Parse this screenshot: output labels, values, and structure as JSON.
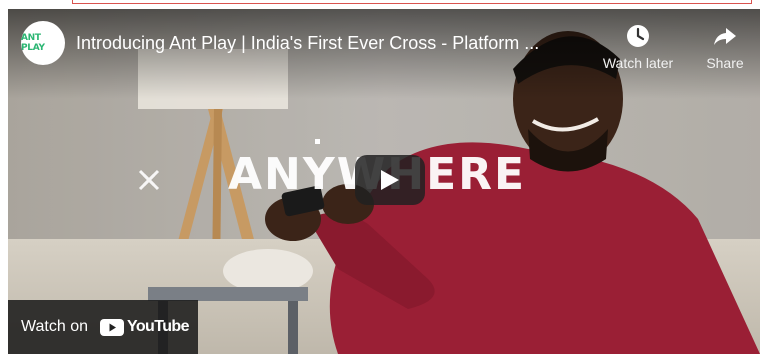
{
  "channel": {
    "logo_text": "ANT PLAY"
  },
  "video": {
    "title": "Introducing Ant Play | India's First Ever Cross - Platform ...",
    "overlay_text": "ANYWHERE"
  },
  "actions": {
    "watch_later_label": "Watch later",
    "share_label": "Share"
  },
  "footer": {
    "watch_on_label": "Watch on",
    "youtube_label": "YouTube"
  },
  "colors": {
    "brand_green": "#2bb673",
    "youtube_red": "#ff0000",
    "shirt_red": "#9a1f35"
  },
  "icons": [
    "clock-icon",
    "share-arrow-icon",
    "play-icon",
    "youtube-logo-icon",
    "x-mark-icon"
  ]
}
